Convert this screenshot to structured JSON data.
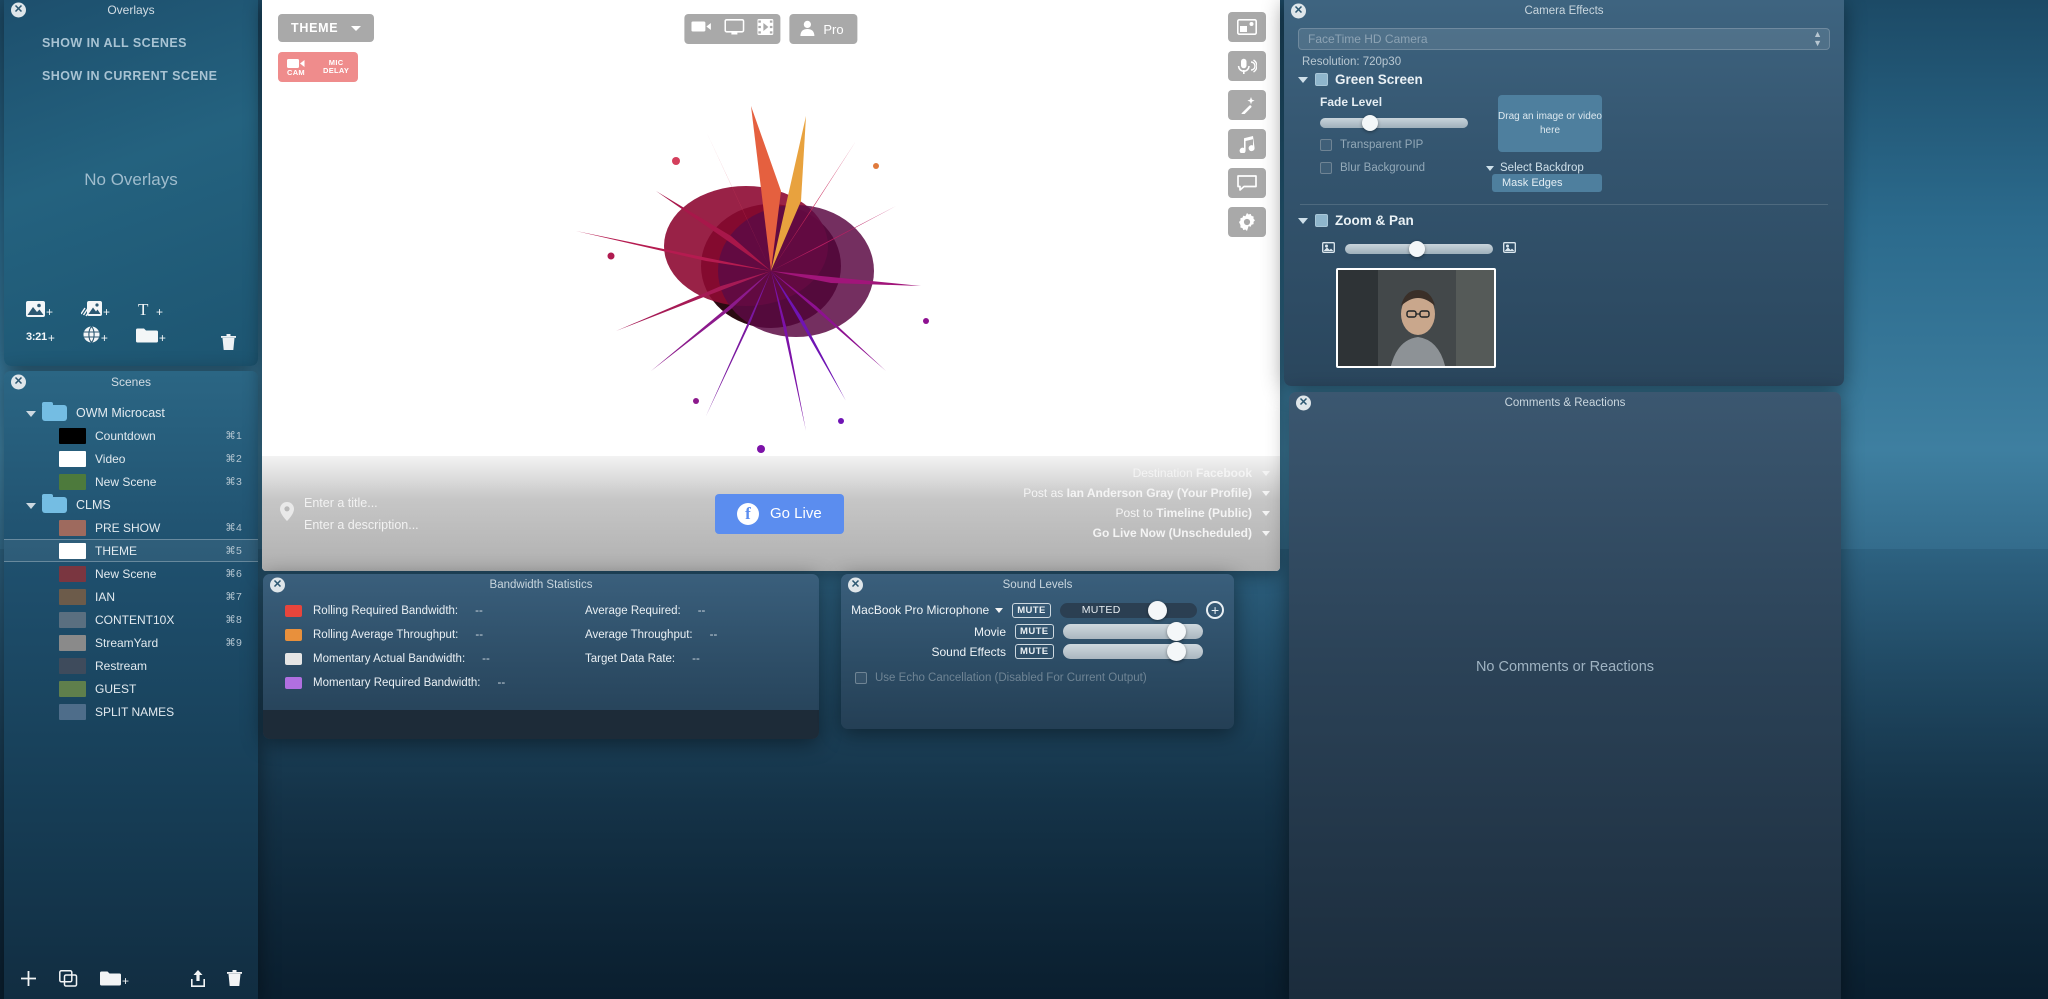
{
  "overlays": {
    "title": "Overlays",
    "actions": [
      "SHOW IN ALL SCENES",
      "SHOW IN CURRENT SCENE"
    ],
    "empty_text": "No Overlays",
    "toolbar": {
      "add_image": "add-image",
      "add_animated_image": "add-animated-image",
      "add_text": "add-text",
      "timer_label": "3:21",
      "add_web": "add-web",
      "add_folder": "add-folder",
      "delete": "delete"
    }
  },
  "scenes": {
    "title": "Scenes",
    "items": [
      {
        "name": "OWM Microcast",
        "key": "",
        "type": "folder",
        "indent": 0,
        "selected": false,
        "thumb": "#74bde3"
      },
      {
        "name": "Countdown",
        "key": "⌘1",
        "type": "scene",
        "indent": 1,
        "selected": false,
        "thumb": "#000000"
      },
      {
        "name": "Video",
        "key": "⌘2",
        "type": "scene",
        "indent": 1,
        "selected": false,
        "thumb": "#ffffff"
      },
      {
        "name": "New Scene",
        "key": "⌘3",
        "type": "scene",
        "indent": 1,
        "selected": false,
        "thumb": "#4d7a3c"
      },
      {
        "name": "CLMS",
        "key": "",
        "type": "folder",
        "indent": 0,
        "selected": false,
        "thumb": "#74bde3"
      },
      {
        "name": "PRE SHOW",
        "key": "⌘4",
        "type": "scene",
        "indent": 1,
        "selected": false,
        "thumb": "#9e6a5e"
      },
      {
        "name": "THEME",
        "key": "⌘5",
        "type": "scene",
        "indent": 1,
        "selected": true,
        "thumb": "#ffffff"
      },
      {
        "name": "New Scene",
        "key": "⌘6",
        "type": "scene",
        "indent": 1,
        "selected": false,
        "thumb": "#7a3640"
      },
      {
        "name": "IAN",
        "key": "⌘7",
        "type": "scene",
        "indent": 1,
        "selected": false,
        "thumb": "#6c5b4a"
      },
      {
        "name": "CONTENT10X",
        "key": "⌘8",
        "type": "scene",
        "indent": 1,
        "selected": false,
        "thumb": "#5a6f80"
      },
      {
        "name": "StreamYard",
        "key": "⌘9",
        "type": "scene",
        "indent": 1,
        "selected": false,
        "thumb": "#8a8a8a"
      },
      {
        "name": "Restream",
        "key": "",
        "type": "scene",
        "indent": 1,
        "selected": false,
        "thumb": "#3e4b5c"
      },
      {
        "name": "GUEST",
        "key": "",
        "type": "scene",
        "indent": 1,
        "selected": false,
        "thumb": "#5f7f4c"
      },
      {
        "name": "SPLIT NAMES",
        "key": "",
        "type": "scene",
        "indent": 1,
        "selected": false,
        "thumb": "#4e6d8a"
      }
    ],
    "toolbar": {
      "add": "+",
      "duplicate": "duplicate-scene",
      "add_folder": "add-folder",
      "share": "share",
      "delete": "delete"
    }
  },
  "stage": {
    "theme_button": "THEME",
    "cam_button": {
      "cam_label": "CAM",
      "mic_label_1": "MIC",
      "mic_label_2": "DELAY"
    },
    "top_center": {
      "pro_label": "Pro"
    },
    "rail": [
      "layout-icon",
      "microphone-icon",
      "magic-wand-icon",
      "music-note-icon",
      "comment-icon",
      "gear-icon"
    ],
    "title_placeholder": "Enter a title...",
    "description_placeholder": "Enter a description...",
    "go_live_label": "Go Live",
    "destination": [
      {
        "label": "Destination",
        "value": "Facebook"
      },
      {
        "label": "Post as",
        "value": "Ian Anderson Gray (Your Profile)"
      },
      {
        "label": "Post to",
        "value": "Timeline (Public)"
      },
      {
        "label": "",
        "value": "Go Live Now (Unscheduled)"
      }
    ],
    "accent_blue": "#5b8def"
  },
  "bandwidth": {
    "title": "Bandwidth Statistics",
    "left": [
      {
        "label": "Rolling Required Bandwidth:",
        "value": "--",
        "color": "#e8453c"
      },
      {
        "label": "Rolling Average Throughput:",
        "value": "--",
        "color": "#e8903c"
      },
      {
        "label": "Momentary Actual Bandwidth:",
        "value": "--",
        "color": "#e5e5e5"
      },
      {
        "label": "Momentary Required Bandwidth:",
        "value": "--",
        "color": "#b06fe0"
      }
    ],
    "right": [
      {
        "label": "Average Required:",
        "value": "--"
      },
      {
        "label": "Average Throughput:",
        "value": "--"
      },
      {
        "label": "Target Data Rate:",
        "value": "--"
      }
    ]
  },
  "sound": {
    "title": "Sound Levels",
    "rows": [
      {
        "label": "MacBook Pro Microphone",
        "has_caret": true,
        "mute": "MUTE",
        "muted": true,
        "muted_text": "MUTED",
        "knob": 0.72,
        "has_plus": true
      },
      {
        "label": "Movie",
        "has_caret": false,
        "mute": "MUTE",
        "muted": false,
        "muted_text": "",
        "knob": 0.86,
        "has_plus": false
      },
      {
        "label": "Sound Effects",
        "has_caret": false,
        "mute": "MUTE",
        "muted": false,
        "muted_text": "",
        "knob": 0.86,
        "has_plus": false
      }
    ],
    "echo_label": "Use Echo Cancellation (Disabled For Current Output)"
  },
  "camera_effects": {
    "title": "Camera Effects",
    "device": "FaceTime HD Camera",
    "resolution": "Resolution: 720p30",
    "green_screen": {
      "title": "Green Screen",
      "fade_label": "Fade Level",
      "transparent_pip": "Transparent PIP",
      "blur_background": "Blur Background",
      "drop_text": "Drag an image or video here",
      "select_backdrop": "Select Backdrop",
      "mask_edges": "Mask Edges"
    },
    "zoom_pan": {
      "title": "Zoom & Pan"
    }
  },
  "comments": {
    "title": "Comments & Reactions",
    "empty_text": "No Comments or Reactions"
  }
}
